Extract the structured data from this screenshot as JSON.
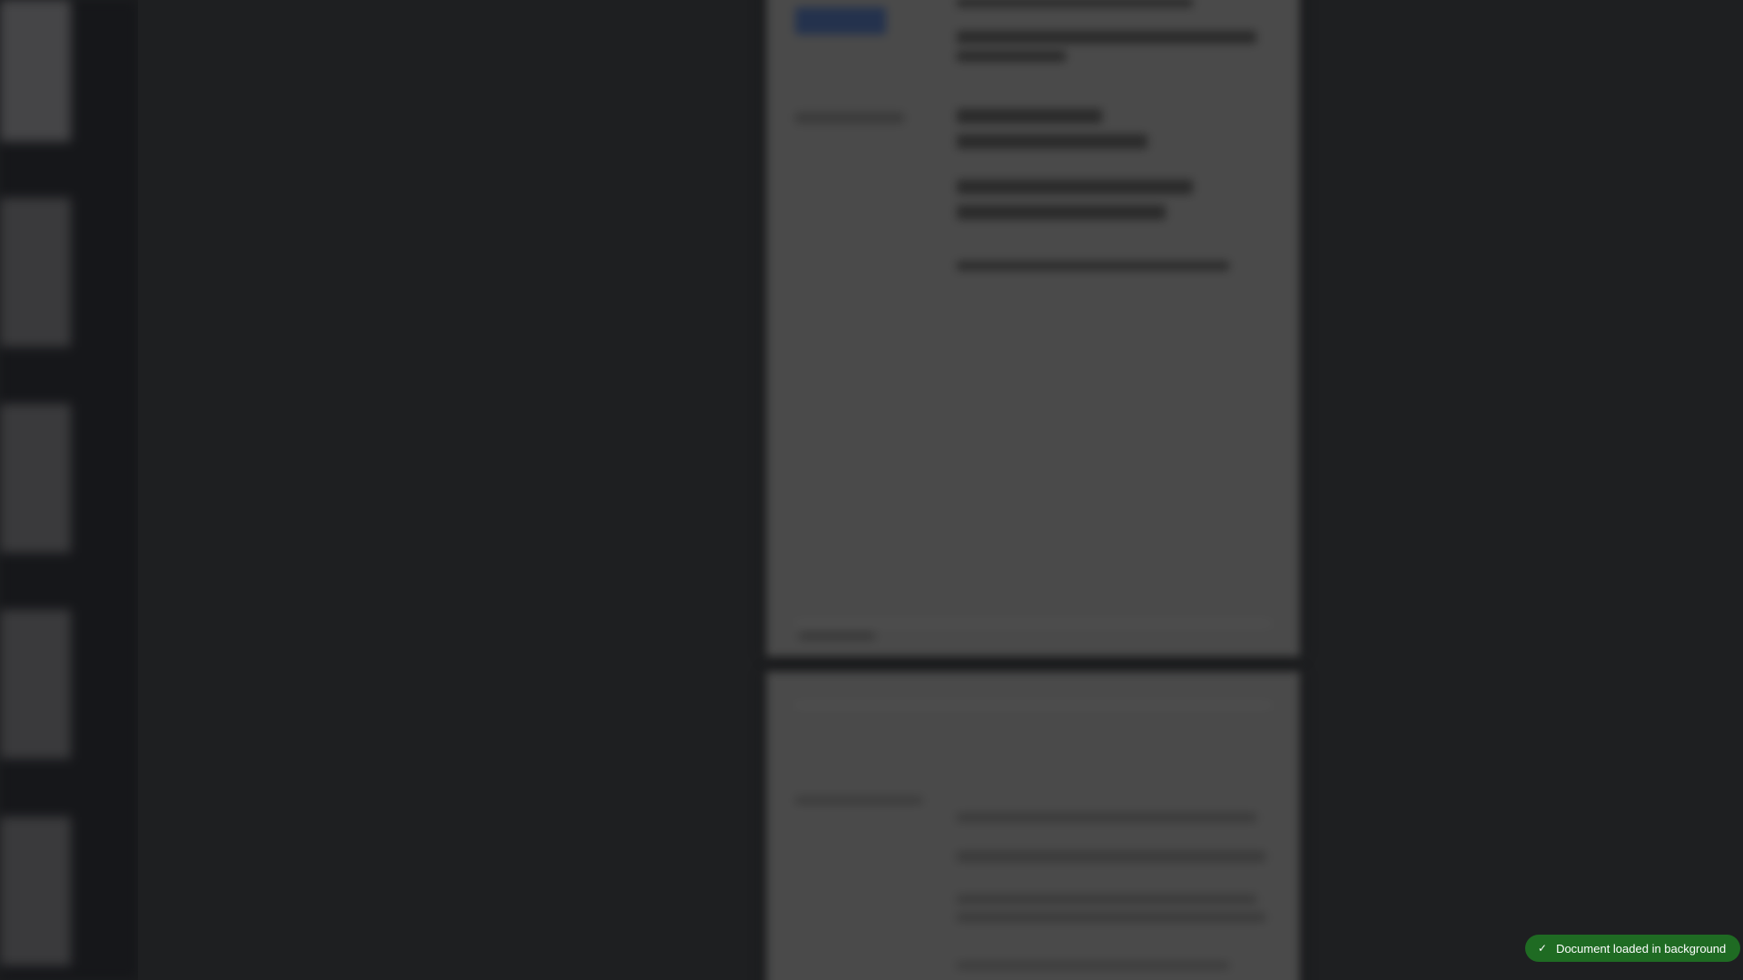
{
  "toast": {
    "icon": "check-icon",
    "message": "Document loaded in background",
    "color": "#1f6b23"
  }
}
